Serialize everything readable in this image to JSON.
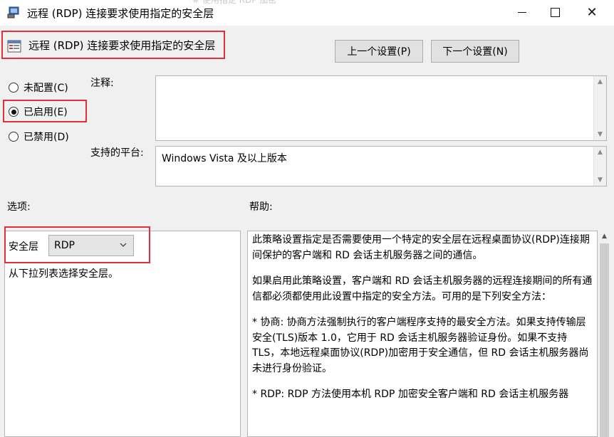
{
  "window": {
    "title": "远程 (RDP) 连接要求使用指定的安全层",
    "ghost_title": "# 使用指定 RDP 加密",
    "controls": {
      "minimize": "minimize",
      "maximize": "maximize",
      "close": "✕"
    }
  },
  "header": {
    "title": "远程 (RDP) 连接要求使用指定的安全层",
    "prev_button": "上一个设置(P)",
    "next_button": "下一个设置(N)"
  },
  "state": {
    "options": [
      {
        "label": "未配置(C)",
        "selected": false
      },
      {
        "label": "已启用(E)",
        "selected": true
      },
      {
        "label": "已禁用(D)",
        "selected": false
      }
    ]
  },
  "comment": {
    "label": "注释:",
    "value": ""
  },
  "platform": {
    "label": "支持的平台:",
    "value": "Windows Vista 及以上版本"
  },
  "options_section": {
    "label": "选项:",
    "security_layer_label": "安全层",
    "security_layer_value": "RDP",
    "hint": "从下拉列表选择安全层。"
  },
  "help_section": {
    "label": "帮助:",
    "paragraphs": [
      "此策略设置指定是否需要使用一个特定的安全层在远程桌面协议(RDP)连接期间保护的客户端和 RD 会话主机服务器之间的通信。",
      "如果启用此策略设置，客户端和 RD 会话主机服务器的远程连接期间的所有通信都必须都使用此设置中指定的安全方法。可用的是下列安全方法：",
      "* 协商: 协商方法强制执行的客户端程序支持的最安全方法。如果支持传输层安全(TLS)版本 1.0，它用于 RD 会话主机服务器验证身份。如果不支持 TLS，本地远程桌面协议(RDP)加密用于安全通信，但 RD 会话主机服务器尚未进行身份验证。",
      "* RDP: RDP 方法使用本机 RDP 加密安全客户端和 RD 会话主机服务器"
    ]
  },
  "colors": {
    "highlight_border": "#e0313a",
    "background": "#f0f0f0",
    "button": "#e1e1e1"
  }
}
